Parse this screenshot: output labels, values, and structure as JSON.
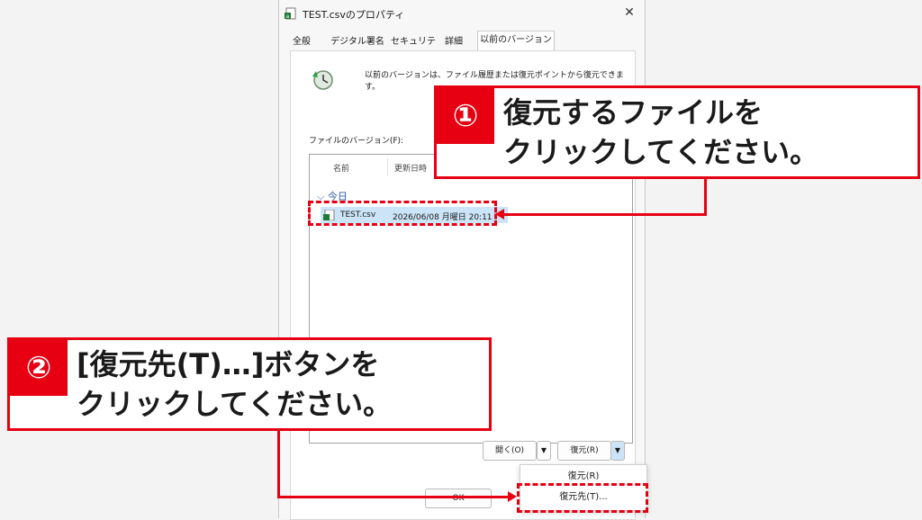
{
  "dialog": {
    "title": "TEST.csvのプロパティ",
    "close_symbol": "✕",
    "tabs": [
      {
        "label": "全般",
        "selected": false
      },
      {
        "label": "デジタル署名",
        "selected": false
      },
      {
        "label": "セキュリティ",
        "selected": false
      },
      {
        "label": "詳細",
        "selected": false
      },
      {
        "label": "以前のバージョン",
        "selected": true
      }
    ],
    "description": "以前のバージョンは、ファイル履歴または復元ポイントから復元できます。",
    "versions_label": "ファイルのバージョン(F):",
    "columns": [
      "名前",
      "更新日時"
    ],
    "group_label": "⌵ 今日",
    "rows": [
      {
        "name": "TEST.csv",
        "date": "2026/06/08 月曜日 20:11"
      }
    ],
    "buttons": {
      "open": "開く(O)",
      "restore": "復元(R)",
      "ok": "OK",
      "arrow": "▼"
    },
    "menu": {
      "restore": "復元(R)",
      "restore_to": "復元先(T)..."
    }
  },
  "callouts": {
    "one": {
      "badge": "①",
      "line1": "復元するファイルを",
      "line2": "クリックしてください。"
    },
    "two": {
      "badge": "②",
      "line1": "[復元先(T)…]ボタンを",
      "line2": "クリックしてください。"
    }
  },
  "colors": {
    "accent": "#e60012",
    "selection": "#cce4f7",
    "group": "#2c5fa8"
  },
  "icons": [
    "csv-file-icon",
    "history-clock-icon",
    "close-icon",
    "chevron-down-icon"
  ]
}
